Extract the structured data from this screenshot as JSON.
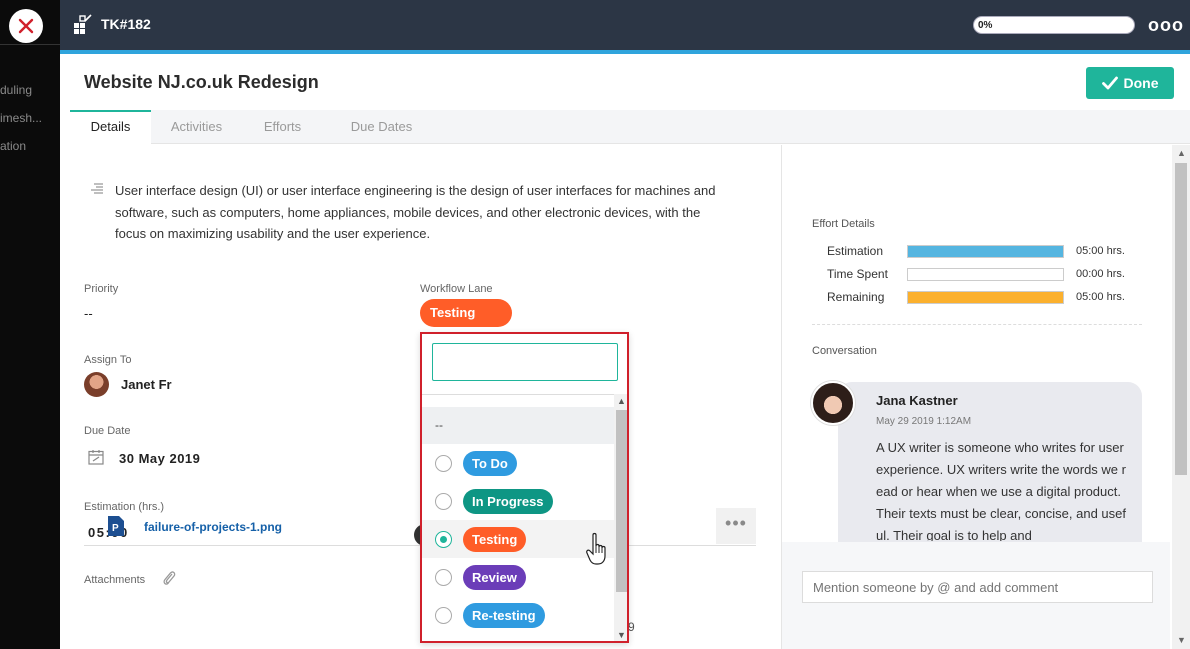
{
  "rail": {
    "items": [
      "duling",
      "imesh...",
      "ation"
    ]
  },
  "header": {
    "task_id": "TK#182",
    "progress_label": "0%",
    "progress_fraction": 0.0,
    "more_label": "ooo"
  },
  "page": {
    "title": "Website NJ.co.uk Redesign",
    "done_label": "Done"
  },
  "tabs": [
    {
      "label": "Details",
      "active": true
    },
    {
      "label": "Activities",
      "active": false
    },
    {
      "label": "Efforts",
      "active": false
    },
    {
      "label": "Due Dates",
      "active": false
    }
  ],
  "details": {
    "description": "User interface design (UI) or user interface engineering is the design of user interfaces for machines and software, such as computers, home appliances, mobile devices, and other electronic devices, with the focus on maximizing usability and the user experience.",
    "priority_label": "Priority",
    "priority_value": "--",
    "assign_label": "Assign To",
    "assignee": "Janet Fr",
    "due_label": "Due Date",
    "due_value": "30 May 2019",
    "estimation_label": "Estimation (hrs.)",
    "estimation_value": "05:00",
    "attachments_label": "Attachments",
    "file_name": "failure-of-projects-1.png",
    "file_more": "•••",
    "year_peek": "9"
  },
  "workflow": {
    "label": "Workflow Lane",
    "current": "Testing",
    "none_option": "--",
    "options": [
      {
        "label": "To Do",
        "color": "#2f9be0",
        "selected": false
      },
      {
        "label": "In Progress",
        "color": "#0e9684",
        "selected": false
      },
      {
        "label": "Testing",
        "color": "#ff5d28",
        "selected": true
      },
      {
        "label": "Review",
        "color": "#6b3db8",
        "selected": false
      },
      {
        "label": "Re-testing",
        "color": "#2f9be0",
        "selected": false
      },
      {
        "label": "",
        "color": "#3aa94a",
        "selected": false
      }
    ]
  },
  "effort": {
    "title": "Effort Details",
    "rows": [
      {
        "label": "Estimation",
        "value": "05:00 hrs.",
        "fraction": 1.0,
        "color": "#55b5e0"
      },
      {
        "label": "Time Spent",
        "value": "00:00 hrs.",
        "fraction": 0.0,
        "color": "#55b5e0"
      },
      {
        "label": "Remaining",
        "value": "05:00 hrs.",
        "fraction": 1.0,
        "color": "#fbb02d"
      }
    ]
  },
  "conversation": {
    "title": "Conversation",
    "author": "Jana Kastner",
    "timestamp": "May 29 2019 1:12AM",
    "message": "A UX writer is someone who writes for user experience. UX writers write the words we read or hear when we use a digital product. Their texts must be clear, concise, and useful. Their goal is to help and",
    "comment_placeholder": "Mention someone by @ and add comment"
  },
  "colors": {
    "accent": "#1fb59b",
    "topbar": "#2c3645",
    "highlight_border": "#d0202b"
  }
}
